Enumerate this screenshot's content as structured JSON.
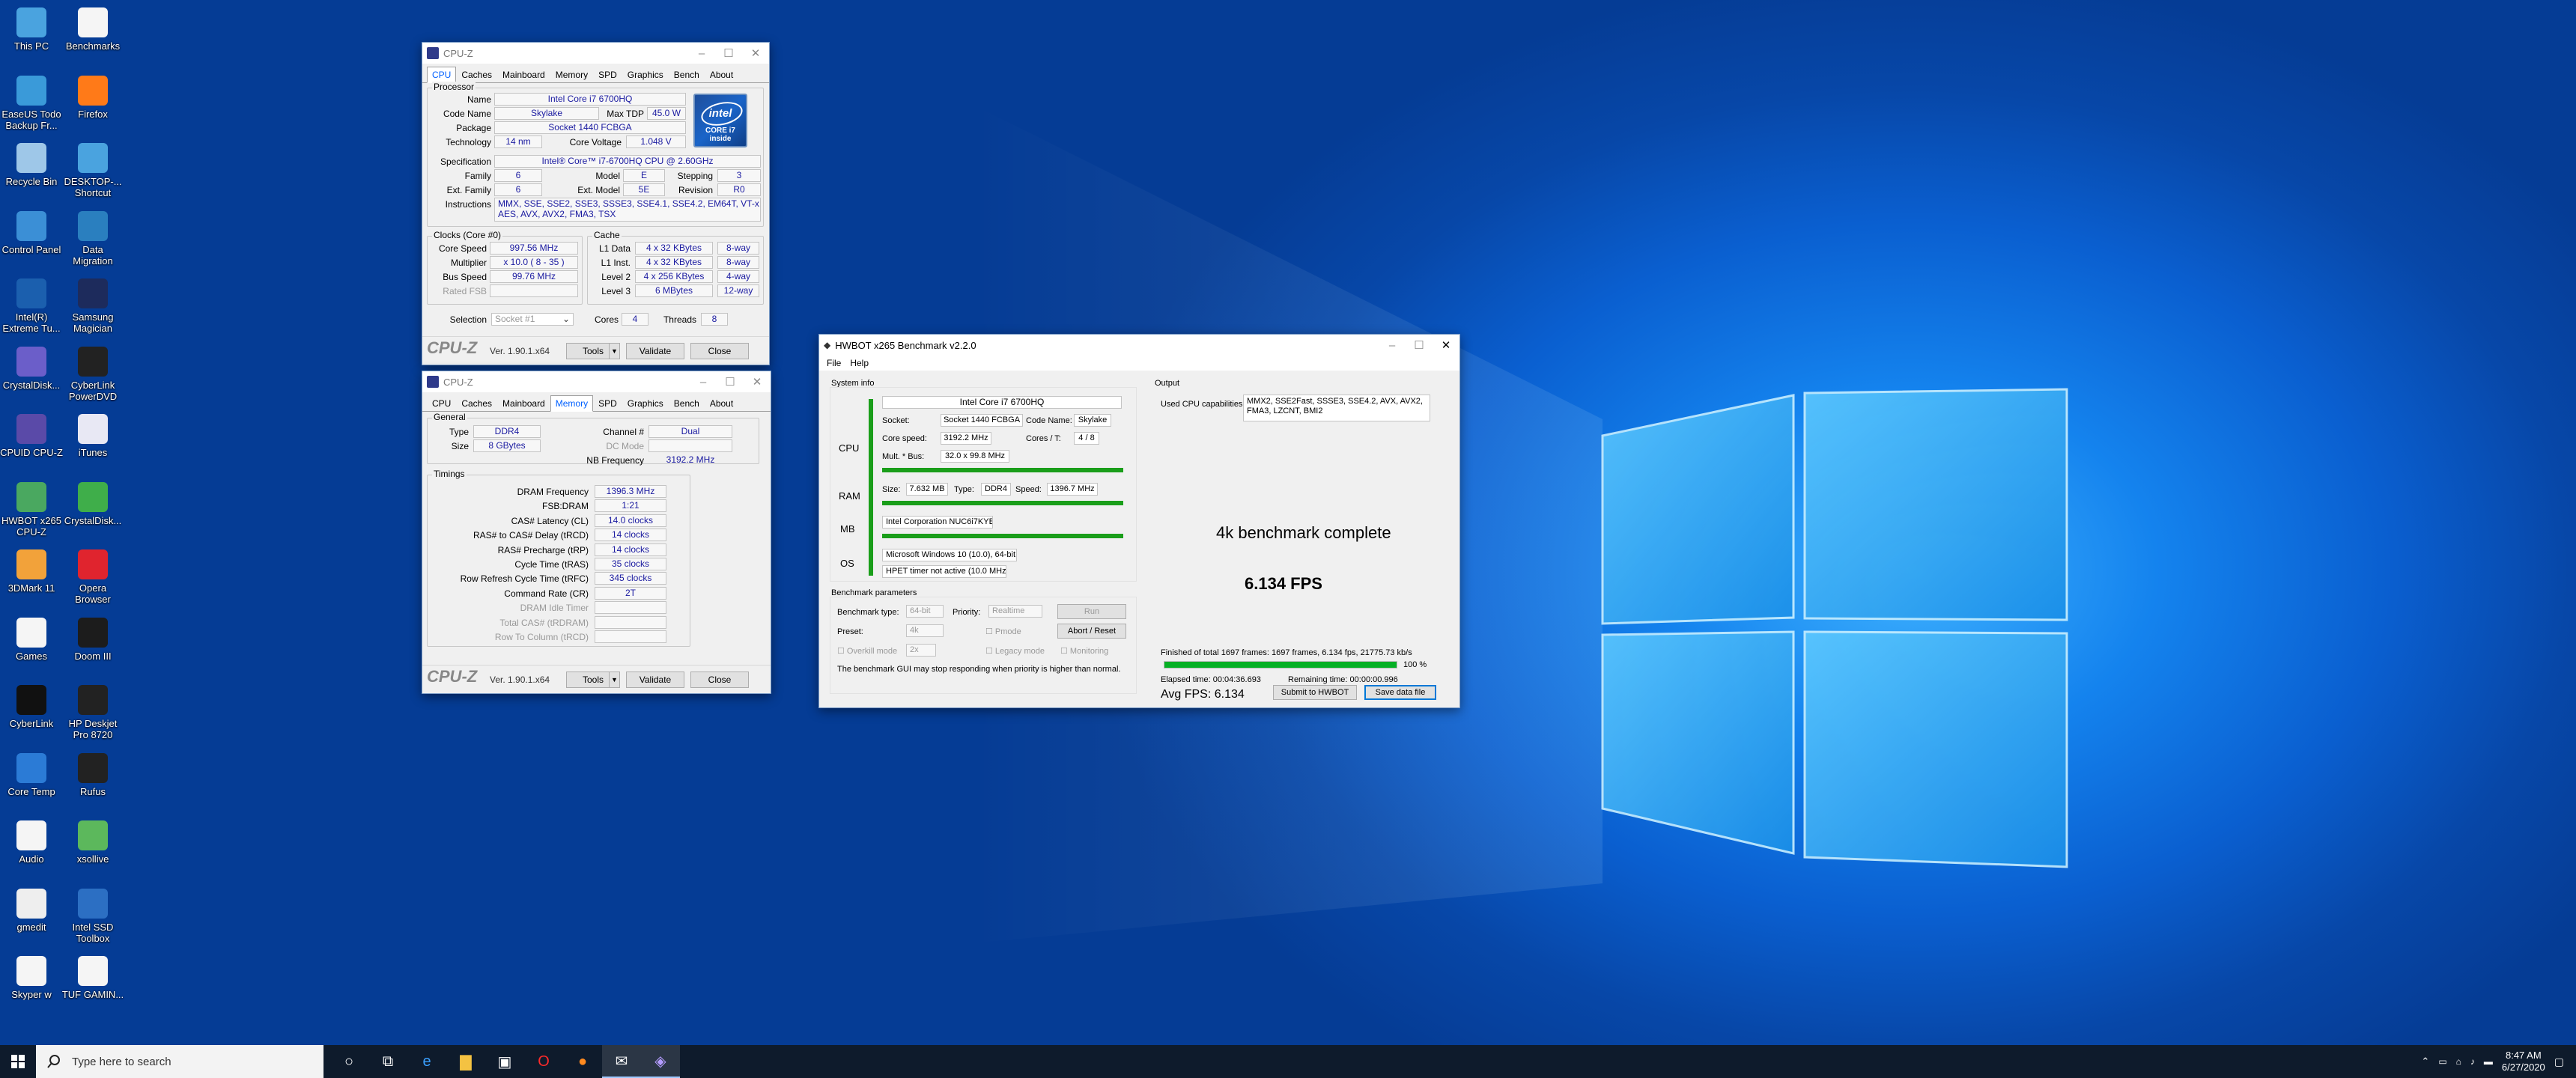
{
  "desktop": {
    "icons": [
      {
        "label": "This PC",
        "icon": "monitor-icon",
        "color": "#4aa3df"
      },
      {
        "label": "Benchmarks",
        "icon": "file-icon",
        "color": "#f5f5f5"
      },
      {
        "label": "EaseUS Todo Backup Fr...",
        "icon": "easeus-icon",
        "color": "#3a9ad9"
      },
      {
        "label": "Firefox",
        "icon": "firefox-icon",
        "color": "#ff7a18"
      },
      {
        "label": "Recycle Bin",
        "icon": "recycle-bin-icon",
        "color": "#9ec7e8"
      },
      {
        "label": "DESKTOP-... Shortcut",
        "icon": "shortcut-icon",
        "color": "#4aa3df"
      },
      {
        "label": "Control Panel",
        "icon": "control-panel-icon",
        "color": "#3b8fd6"
      },
      {
        "label": "Data Migration",
        "icon": "data-migration-icon",
        "color": "#2a7fbf"
      },
      {
        "label": "Intel(R) Extreme Tu...",
        "icon": "intel-xtu-icon",
        "color": "#1b5fae"
      },
      {
        "label": "Samsung Magician",
        "icon": "samsung-magician-icon",
        "color": "#1d2b5c"
      },
      {
        "label": "CrystalDisk...",
        "icon": "crystaldisk-icon",
        "color": "#6b5ec9"
      },
      {
        "label": "CyberLink PowerDVD",
        "icon": "powerdvd-icon",
        "color": "#222222"
      },
      {
        "label": "CPUID CPU-Z",
        "icon": "cpuz-icon",
        "color": "#5a4aa8"
      },
      {
        "label": "iTunes",
        "icon": "itunes-icon",
        "color": "#e8e8f4"
      },
      {
        "label": "HWBOT x265 CPU-Z",
        "icon": "hwbot-icon",
        "color": "#4aa860"
      },
      {
        "label": "CrystalDisk...",
        "icon": "crystaldisk2-icon",
        "color": "#3fae4a"
      },
      {
        "label": "3DMark 11",
        "icon": "3dmark-icon",
        "color": "#f2a23a"
      },
      {
        "label": "Opera Browser",
        "icon": "opera-icon",
        "color": "#e0242e"
      },
      {
        "label": "Games",
        "icon": "file-icon",
        "color": "#f5f5f5"
      },
      {
        "label": "Doom III",
        "icon": "doom-icon",
        "color": "#1c1c1c"
      },
      {
        "label": "CyberLink",
        "icon": "cyberlink-icon",
        "color": "#111111"
      },
      {
        "label": "HP Deskjet Pro 8720",
        "icon": "printer-icon",
        "color": "#222222"
      },
      {
        "label": "Core Temp",
        "icon": "core-temp-icon",
        "color": "#2b7bd6"
      },
      {
        "label": "Rufus",
        "icon": "rufus-icon",
        "color": "#222222"
      },
      {
        "label": "Audio",
        "icon": "audio-icon",
        "color": "#f5f5f5"
      },
      {
        "label": "xsollive",
        "icon": "xsollive-icon",
        "color": "#5cb85c"
      },
      {
        "label": "gmedit",
        "icon": "gmedit-icon",
        "color": "#eeeeee"
      },
      {
        "label": "Intel SSD Toolbox",
        "icon": "intel-ssd-icon",
        "color": "#2c6fc3"
      },
      {
        "label": "Skyper w",
        "icon": "skyper-icon",
        "color": "#f5f5f5"
      },
      {
        "label": "TUF GAMIN...",
        "icon": "tuf-icon",
        "color": "#f5f5f5"
      }
    ]
  },
  "cpuz1": {
    "title": "CPU-Z",
    "tabs": [
      "CPU",
      "Caches",
      "Mainboard",
      "Memory",
      "SPD",
      "Graphics",
      "Bench",
      "About"
    ],
    "active_tab": "CPU",
    "processor_group": "Processor",
    "labels": {
      "name": "Name",
      "code_name": "Code Name",
      "max_tdp": "Max TDP",
      "package": "Package",
      "technology": "Technology",
      "core_voltage": "Core Voltage",
      "specification": "Specification",
      "family": "Family",
      "model": "Model",
      "stepping": "Stepping",
      "ext_family": "Ext. Family",
      "ext_model": "Ext. Model",
      "revision": "Revision",
      "instructions": "Instructions"
    },
    "values": {
      "name": "Intel Core i7 6700HQ",
      "code_name": "Skylake",
      "max_tdp": "45.0 W",
      "package": "Socket 1440 FCBGA",
      "technology": "14 nm",
      "core_voltage": "1.048 V",
      "specification": "Intel® Core™ i7-6700HQ CPU @ 2.60GHz",
      "family": "6",
      "model": "E",
      "stepping": "3",
      "ext_family": "6",
      "ext_model": "5E",
      "revision": "R0",
      "instructions_1": "MMX, SSE, SSE2, SSE3, SSSE3, SSE4.1, SSE4.2, EM64T, VT-x,",
      "instructions_2": "AES, AVX, AVX2, FMA3, TSX"
    },
    "intel_badge": {
      "brand": "intel",
      "line1": "CORE i7",
      "line2": "inside"
    },
    "clocks": {
      "title": "Clocks (Core #0)",
      "core_speed_label": "Core Speed",
      "core_speed": "997.56 MHz",
      "multiplier_label": "Multiplier",
      "multiplier": "x 10.0 ( 8 - 35 )",
      "bus_speed_label": "Bus Speed",
      "bus_speed": "99.76 MHz",
      "rated_fsb_label": "Rated FSB",
      "rated_fsb": ""
    },
    "cache": {
      "title": "Cache",
      "rows": [
        {
          "label": "L1 Data",
          "size": "4 x 32 KBytes",
          "way": "8-way"
        },
        {
          "label": "L1 Inst.",
          "size": "4 x 32 KBytes",
          "way": "8-way"
        },
        {
          "label": "Level 2",
          "size": "4 x 256 KBytes",
          "way": "4-way"
        },
        {
          "label": "Level 3",
          "size": "6 MBytes",
          "way": "12-way"
        }
      ]
    },
    "selection_label": "Selection",
    "selection_value": "Socket #1",
    "cores_label": "Cores",
    "cores": "4",
    "threads_label": "Threads",
    "threads": "8",
    "footer": {
      "logo": "CPU-Z",
      "version": "Ver. 1.90.1.x64",
      "tools": "Tools",
      "validate": "Validate",
      "close": "Close"
    }
  },
  "cpuz2": {
    "title": "CPU-Z",
    "tabs": [
      "CPU",
      "Caches",
      "Mainboard",
      "Memory",
      "SPD",
      "Graphics",
      "Bench",
      "About"
    ],
    "active_tab": "Memory",
    "general": {
      "title": "General",
      "type_label": "Type",
      "type": "DDR4",
      "size_label": "Size",
      "size": "8 GBytes",
      "channel_label": "Channel #",
      "channel": "Dual",
      "dc_mode_label": "DC Mode",
      "dc_mode": "",
      "nb_freq_label": "NB Frequency",
      "nb_freq": "3192.2 MHz"
    },
    "timings": {
      "title": "Timings",
      "rows": [
        {
          "label": "DRAM Frequency",
          "value": "1396.3 MHz",
          "dim": false
        },
        {
          "label": "FSB:DRAM",
          "value": "1:21",
          "dim": false
        },
        {
          "label": "CAS# Latency (CL)",
          "value": "14.0 clocks",
          "dim": false
        },
        {
          "label": "RAS# to CAS# Delay (tRCD)",
          "value": "14 clocks",
          "dim": false
        },
        {
          "label": "RAS# Precharge (tRP)",
          "value": "14 clocks",
          "dim": false
        },
        {
          "label": "Cycle Time (tRAS)",
          "value": "35 clocks",
          "dim": false
        },
        {
          "label": "Row Refresh Cycle Time (tRFC)",
          "value": "345 clocks",
          "dim": false
        },
        {
          "label": "Command Rate (CR)",
          "value": "2T",
          "dim": false
        },
        {
          "label": "DRAM Idle Timer",
          "value": "",
          "dim": true
        },
        {
          "label": "Total CAS# (tRDRAM)",
          "value": "",
          "dim": true
        },
        {
          "label": "Row To Column (tRCD)",
          "value": "",
          "dim": true
        }
      ]
    },
    "footer": {
      "logo": "CPU-Z",
      "version": "Ver. 1.90.1.x64",
      "tools": "Tools",
      "validate": "Validate",
      "close": "Close"
    }
  },
  "hwbot": {
    "title": "HWBOT x265 Benchmark v2.2.0",
    "menu": [
      "File",
      "Help"
    ],
    "system_info": "System info",
    "side": {
      "cpu": "CPU",
      "ram": "RAM",
      "mb": "MB",
      "os": "OS"
    },
    "cpu_name": "Intel Core i7 6700HQ",
    "socket_label": "Socket:",
    "socket": "Socket 1440 FCBGA",
    "codename_label": "Code Name:",
    "codename": "Skylake",
    "core_speed_label": "Core speed:",
    "core_speed": "3192.2 MHz",
    "cores_label": "Cores / T:",
    "cores": "4 / 8",
    "mult_label": "Mult. * Bus:",
    "mult": "32.0 x 99.8 MHz",
    "ram_size_label": "Size:",
    "ram_size": "7.632 MB",
    "ram_type_label": "Type:",
    "ram_type": "DDR4",
    "ram_speed_label": "Speed:",
    "ram_speed": "1396.7 MHz",
    "mb": "Intel Corporation NUC6i7KYB",
    "os": "Microsoft Windows 10 (10.0), 64-bit",
    "hpet": "HPET timer not active (10.0 MHz)",
    "output_label": "Output",
    "used_caps_label": "Used CPU capabilities:",
    "used_caps": "MMX2, SSE2Fast, SSSE3, SSE4.2, AVX, AVX2, FMA3, LZCNT, BMI2",
    "complete": "4k benchmark complete",
    "fps": "6.134 FPS",
    "bench_params": "Benchmark parameters",
    "bench_type_label": "Benchmark type:",
    "bench_type": "64-bit",
    "priority_label": "Priority:",
    "priority": "Realtime",
    "run": "Run",
    "preset_label": "Preset:",
    "preset": "4k",
    "pmode": "Pmode",
    "abort": "Abort / Reset",
    "overkill": "Overkill mode",
    "overkill_val": "2x",
    "legacy": "Legacy mode",
    "monitoring": "Monitoring",
    "warning": "The benchmark GUI may stop responding when priority is higher than normal.",
    "finished": "Finished of total 1697 frames: 1697 frames, 6.134 fps,  21775.73 kb/s",
    "progress_pct": "100 %",
    "progress_value": 1.0,
    "elapsed": "Elapsed time: 00:04:36.693",
    "remaining": "Remaining time: 00:00:00.996",
    "avg_fps": "Avg FPS: 6.134",
    "submit": "Submit to HWBOT",
    "save": "Save data file"
  },
  "taskbar": {
    "search_placeholder": "Type here to search",
    "apps": [
      "cortana-icon",
      "task-view-icon",
      "edge-icon",
      "file-explorer-icon",
      "store-icon",
      "opera-icon",
      "firefox-icon",
      "mail-icon",
      "cpuz-icon"
    ],
    "time": "8:47 AM",
    "date": "6/27/2020"
  }
}
